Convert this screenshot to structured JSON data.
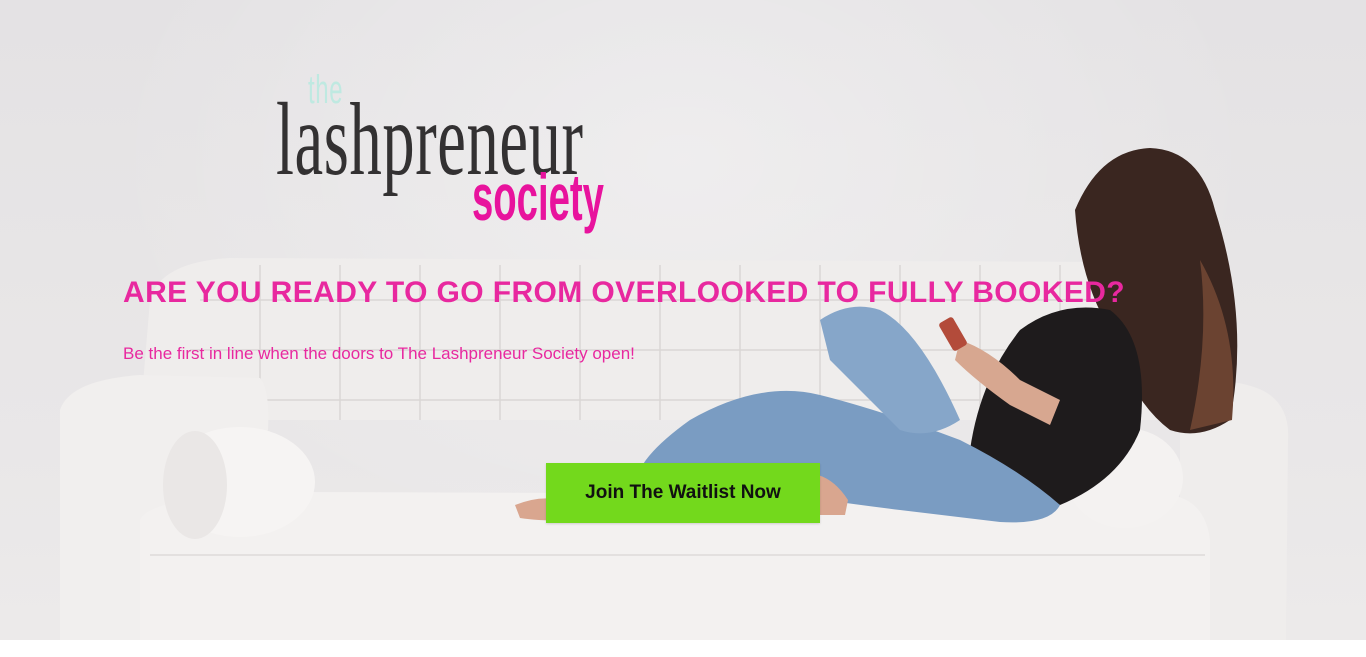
{
  "logo": {
    "the": "the",
    "main": "lashpreneur",
    "society": "society"
  },
  "hero": {
    "headline": "ARE YOU READY TO GO FROM OVERLOOKED TO FULLY BOOKED?",
    "subline": "Be the first in line when the doors to The Lashpreneur Society open!",
    "cta_label": "Join The Waitlist Now"
  },
  "colors": {
    "brand_pink": "#e8289f",
    "logo_mint": "#bfe9e1",
    "logo_dark": "#333132",
    "cta_green": "#73d91c"
  },
  "background_image": "woman-on-white-sofa-photo"
}
